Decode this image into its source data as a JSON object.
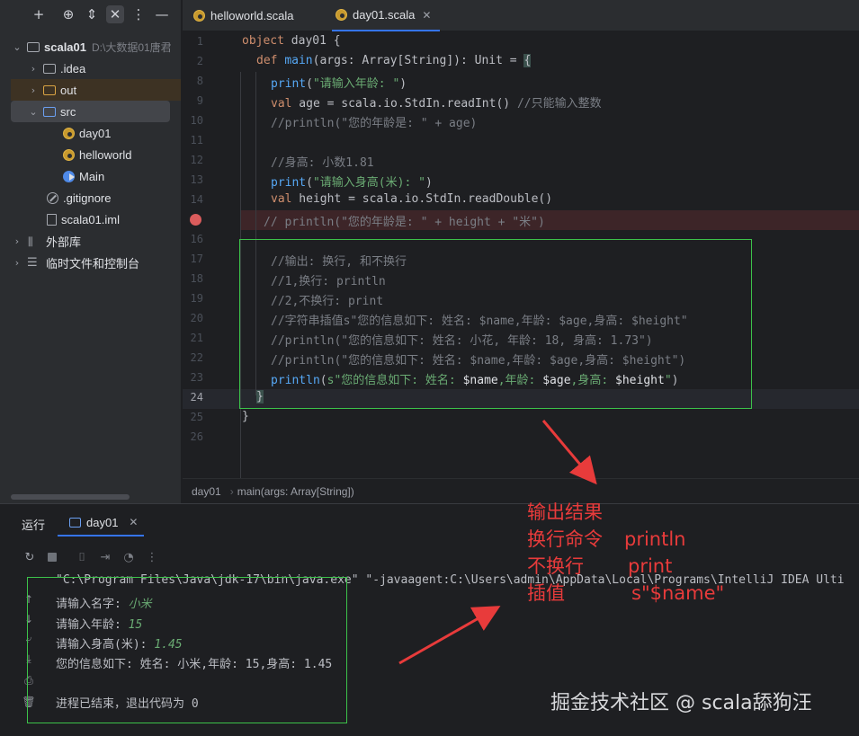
{
  "project_pane": {
    "toolbar_icons": [
      "add-icon",
      "target-icon",
      "expand-icon",
      "collapse-icon",
      "more-icon",
      "minimize-icon"
    ],
    "tree": [
      {
        "label": "scala01",
        "sub": "D:\\大数据01唐君",
        "kind": "project-folder",
        "expanded": true
      },
      {
        "label": ".idea",
        "kind": "folder"
      },
      {
        "label": "out",
        "kind": "folder-excluded"
      },
      {
        "label": "src",
        "kind": "source-folder",
        "expanded": true
      },
      {
        "label": "day01",
        "kind": "scala-object"
      },
      {
        "label": "helloworld",
        "kind": "scala-object"
      },
      {
        "label": "Main",
        "kind": "main-class"
      },
      {
        "label": ".gitignore",
        "kind": "gitignore"
      },
      {
        "label": "scala01.iml",
        "kind": "iml"
      },
      {
        "label": "外部库",
        "kind": "libraries"
      },
      {
        "label": "临时文件和控制台",
        "kind": "scratches"
      }
    ]
  },
  "editor": {
    "tabs": [
      {
        "label": "helloworld.scala",
        "active": false
      },
      {
        "label": "day01.scala",
        "active": true
      }
    ],
    "line_numbers": [
      "1",
      "2",
      "8",
      "9",
      "10",
      "11",
      "12",
      "13",
      "14",
      "15",
      "16",
      "17",
      "18",
      "19",
      "20",
      "21",
      "22",
      "23",
      "24",
      "25",
      "26"
    ],
    "lines": {
      "l1_kw": "object",
      "l1_rest": " day01 {",
      "l2_kw": "def ",
      "l2_fn": "main",
      "l2_rest": "(args: Array[String]): Unit = ",
      "l2_brace": "{",
      "l8_fn": "print",
      "l8_open": "(",
      "l8_str": "\"请输入年龄: \"",
      "l8_close": ")",
      "l9_kw": "val",
      "l9_rest": " age = scala.io.StdIn.readInt() ",
      "l9_comment": "//只能输入整数",
      "l10": "//println(\"您的年龄是: \" + age)",
      "l12": "//身高: 小数1.81",
      "l13_fn": "print",
      "l13_open": "(",
      "l13_str": "\"请输入身高(米): \"",
      "l13_close": ")",
      "l14_kw": "val",
      "l14_rest": " height = scala.io.StdIn.readDouble()",
      "l15": "// println(\"您的年龄是: \" + height + \"米\")",
      "l17": "//输出: 换行, 和不换行",
      "l18": "//1,换行: println",
      "l19": "//2,不换行: print",
      "l20": "//字符串插值s\"您的信息如下: 姓名: $name,年龄: $age,身高: $height\"",
      "l21": "//println(\"您的信息如下: 姓名: 小花, 年龄: 18, 身高: 1.73\")",
      "l22": "//println(\"您的信息如下: 姓名: $name,年龄: $age,身高: $height\")",
      "l23_fn": "println",
      "l23_open": "(",
      "l23_s": "s\"您的信息如下: 姓名: ",
      "l23_v1": "$name",
      "l23_m1": ",年龄: ",
      "l23_v2": "$age",
      "l23_m2": ",身高: ",
      "l23_v3": "$height",
      "l23_end": "\"",
      "l23_close": ")",
      "l24": "}",
      "l25": "}"
    },
    "breadcrumb": [
      "day01",
      "main(args: Array[String])"
    ]
  },
  "run_panel": {
    "title": "运行",
    "tab": "day01",
    "toolbar_icons": [
      "rerun-icon",
      "stop-icon",
      "screenshot-icon",
      "export-icon",
      "profiler-icon",
      "more-icon"
    ],
    "console": [
      {
        "text": "\"C:\\Program Files\\Java\\jdk-17\\bin\\java.exe\" \"-javaagent:C:\\Users\\admin\\AppData\\Local\\Programs\\IntelliJ IDEA Ulti"
      },
      {
        "prompt": "请输入名字: ",
        "input": "小米"
      },
      {
        "prompt": "请输入年龄: ",
        "input": "15"
      },
      {
        "prompt": "请输入身高(米): ",
        "input": "1.45"
      },
      {
        "text": "您的信息如下: 姓名: 小米,年龄: 15,身高: 1.45"
      },
      {
        "text": ""
      },
      {
        "text": "进程已结束，退出代码为 0"
      }
    ]
  },
  "annotations": {
    "left_block": [
      "输出结果",
      "换行命令",
      "不换行",
      "插值"
    ],
    "right_block": [
      "println",
      "print",
      "s\"$name\""
    ],
    "color": "#e83b3b"
  },
  "watermark": "掘金技术社区 @ scala舔狗汪",
  "colors": {
    "background": "#1e1f22",
    "panel": "#2b2d30",
    "keyword": "#cf8e6d",
    "string": "#6aab73",
    "comment": "#7a7e85",
    "function": "#56a8f5",
    "highlight_box": "#3cc24a",
    "accent": "#3574f0"
  }
}
